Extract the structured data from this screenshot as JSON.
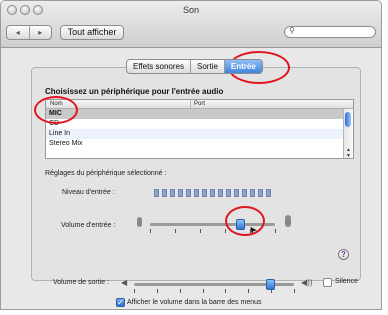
{
  "window": {
    "title": "Son"
  },
  "toolbar": {
    "back": "◂",
    "forward": "▸",
    "show_all_label": "Tout afficher",
    "search_placeholder": ""
  },
  "tabs": [
    {
      "label": "Effets sonores",
      "active": false
    },
    {
      "label": "Sortie",
      "active": false
    },
    {
      "label": "Entrée",
      "active": true
    }
  ],
  "input": {
    "heading": "Choisissez un périphérique pour l'entrée audio",
    "columns": [
      "Nom",
      "Port"
    ],
    "devices": [
      {
        "name": "MIC",
        "port": ""
      },
      {
        "name": "CD",
        "port": ""
      },
      {
        "name": "Line In",
        "port": ""
      },
      {
        "name": "Stereo Mix",
        "port": ""
      }
    ],
    "settings_label": "Réglages du périphérique sélectionné :",
    "level_label": "Niveau d'entrée :",
    "level_segments": 15,
    "volume_label": "Volume d'entrée :",
    "volume": 0.72
  },
  "output": {
    "volume_label": "Volume de sortie :",
    "volume": 0.85,
    "mute_label": "Silence",
    "mute_checked": false,
    "show_in_menubar_label": "Afficher le volume dans la barre des menus",
    "show_in_menubar_checked": true
  },
  "highlight_color": "#e0161f",
  "icons": {
    "help": "?",
    "search": "⚲",
    "speaker_low": "◀",
    "speaker_high": "◀))"
  }
}
